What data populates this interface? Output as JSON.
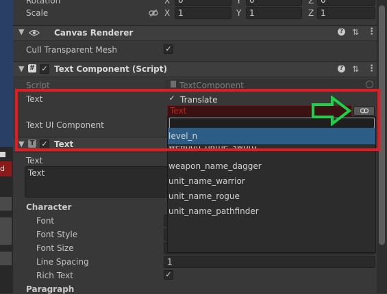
{
  "transform": {
    "rotation_label": "Rotation",
    "scale_label": "Scale",
    "rotation": {
      "x": "0",
      "y": "0",
      "z": "0"
    },
    "scale": {
      "x": "1",
      "y": "1",
      "z": "1"
    },
    "axis_x": "X",
    "axis_y": "Y",
    "axis_z": "Z"
  },
  "canvas_renderer": {
    "title": "Canvas Renderer",
    "cull_label": "Cull Transparent Mesh",
    "cull_checked": true
  },
  "text_component": {
    "title": "Text Component (Script)",
    "script_label": "Script",
    "script_value": "TextComponent",
    "text_label": "Text",
    "translate_label": "Translate",
    "text_value": "Text",
    "ui_component_label": "Text UI Component"
  },
  "dropdown": {
    "search_value": "",
    "items": [
      "level_n",
      "weapon_name_sword",
      "weapon_name_dagger",
      "unit_name_warrior",
      "unit_name_rogue",
      "unit_name_pathfinder"
    ],
    "selected_index": 0
  },
  "text": {
    "title": "Text",
    "text_label": "Text",
    "text_value": "Text",
    "character_label": "Character",
    "font_label": "Font",
    "font_style_label": "Font Style",
    "font_size_label": "Font Size",
    "line_spacing_label": "Line Spacing",
    "line_spacing_value": "1",
    "rich_text_label": "Rich Text",
    "paragraph_label": "Paragraph"
  },
  "left_strip": {
    "red_label": "d"
  },
  "colors": {
    "highlight_box": "#e31b23",
    "arrow": "#1fd148",
    "selection": "#2c5d87"
  },
  "icons": [
    "eye-icon",
    "help-icon",
    "preset-icon",
    "kebab-menu-icon",
    "script-hash-icon",
    "text-t-icon",
    "link-icon",
    "target-icon",
    "script-file-icon"
  ]
}
